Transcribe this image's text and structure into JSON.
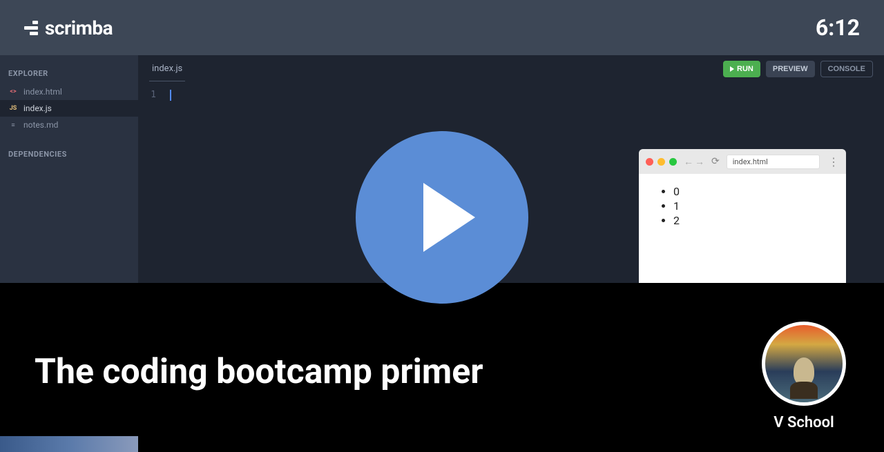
{
  "header": {
    "brand": "scrimba",
    "duration": "6:12"
  },
  "sidebar": {
    "explorer_label": "EXPLORER",
    "dependencies_label": "DEPENDENCIES",
    "files": [
      {
        "name": "index.html",
        "type": "html",
        "icon": "<>"
      },
      {
        "name": "index.js",
        "type": "js",
        "icon": "JS",
        "active": true
      },
      {
        "name": "notes.md",
        "type": "md",
        "icon": "≡"
      }
    ]
  },
  "editor": {
    "active_tab": "index.js",
    "line_number": "1",
    "buttons": {
      "run": "RUN",
      "preview": "PREVIEW",
      "console": "CONSOLE"
    }
  },
  "preview": {
    "url": "index.html",
    "list_items": [
      "0",
      "1",
      "2"
    ]
  },
  "course": {
    "title": "The coding bootcamp primer",
    "author": "V School"
  }
}
